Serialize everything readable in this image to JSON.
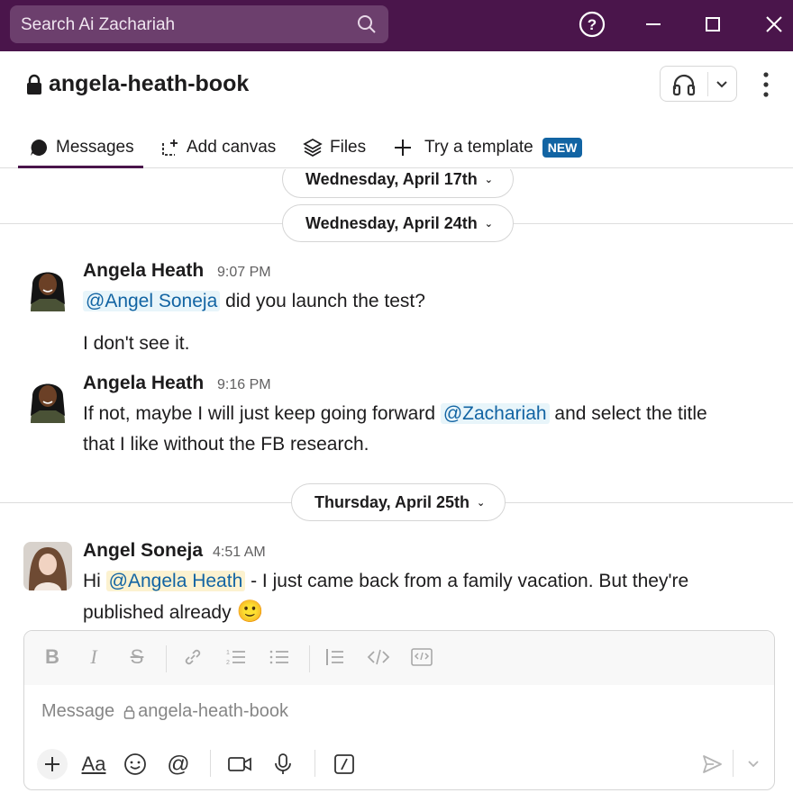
{
  "titlebar": {
    "search_placeholder": "Search Ai Zachariah"
  },
  "channel": {
    "name": "angela-heath-book"
  },
  "tabs": [
    {
      "label": "Messages",
      "active": true
    },
    {
      "label": "Add canvas"
    },
    {
      "label": "Files"
    },
    {
      "label": "Try a template",
      "badge": "NEW"
    }
  ],
  "dates": {
    "d1": "Wednesday, April 17th",
    "d2": "Wednesday, April 24th",
    "d3": "Thursday, April 25th"
  },
  "messages": [
    {
      "author": "Angela Heath",
      "time": "9:07 PM",
      "mention": "@Angel Soneja",
      "text1": " did you launch the test?",
      "text2": "I don't see it."
    },
    {
      "author": "Angela Heath",
      "time": "9:16 PM",
      "pre": "If not, maybe I will just keep going forward ",
      "mention": "@Zachariah",
      "post1": " and select the title",
      "line2": "that I like without the FB research."
    },
    {
      "author": "Angel Soneja",
      "time": "4:51 AM",
      "pre": "Hi ",
      "mention": "@Angela Heath",
      "post1": " - I just came back from a family vacation. But they're",
      "line2": "published already",
      "emoji": "🙂"
    }
  ],
  "composer": {
    "placeholder": "Message",
    "channel": "angela-heath-book"
  },
  "colors": {
    "titlebar": "#4a154b",
    "link": "#1264a3",
    "badge": "#1264a3"
  }
}
